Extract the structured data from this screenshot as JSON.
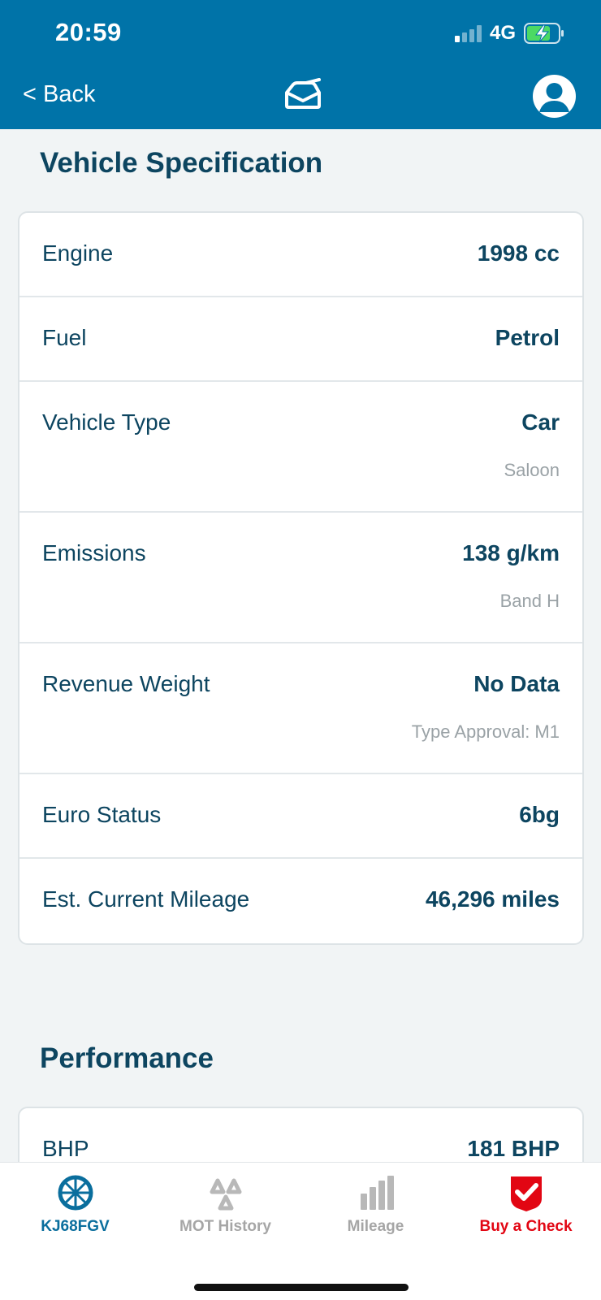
{
  "status": {
    "time": "20:59",
    "network": "4G"
  },
  "header": {
    "back_label": "< Back"
  },
  "spec": {
    "title": "Vehicle Specification",
    "rows": [
      {
        "label": "Engine",
        "value": "1998 cc"
      },
      {
        "label": "Fuel",
        "value": "Petrol"
      },
      {
        "label": "Vehicle Type",
        "value": "Car",
        "sub": "Saloon"
      },
      {
        "label": "Emissions",
        "value": "138 g/km",
        "sub": "Band H"
      },
      {
        "label": "Revenue Weight",
        "value": "No Data",
        "sub": "Type Approval: M1"
      },
      {
        "label": "Euro Status",
        "value": "6bg"
      },
      {
        "label": "Est. Current Mileage",
        "value": "46,296 miles"
      }
    ]
  },
  "performance": {
    "title": "Performance",
    "rows": [
      {
        "label": "BHP",
        "value": "181 BHP"
      }
    ]
  },
  "tabbar": {
    "items": [
      {
        "label": "KJ68FGV",
        "icon": "wheel-icon",
        "color": "#0a6e9d"
      },
      {
        "label": "MOT History",
        "icon": "mot-triangle-icon",
        "color": "#a6a6a6"
      },
      {
        "label": "Mileage",
        "icon": "bar-chart-icon",
        "color": "#a6a6a6"
      },
      {
        "label": "Buy a Check",
        "icon": "check-shield-icon",
        "color": "#e20613"
      }
    ]
  },
  "colors": {
    "header": "#0073a8",
    "accent": "#0d4560",
    "danger": "#e20613"
  }
}
